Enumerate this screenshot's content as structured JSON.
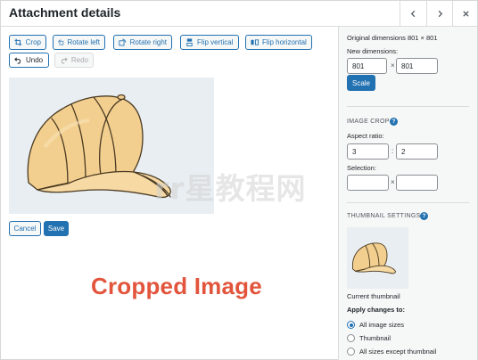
{
  "header": {
    "title": "Attachment details"
  },
  "toolbar": {
    "crop": "Crop",
    "rotate_left": "Rotate left",
    "rotate_right": "Rotate right",
    "flip_vertical": "Flip vertical",
    "flip_horizontal": "Flip horizontal",
    "undo": "Undo",
    "redo": "Redo"
  },
  "editor": {
    "cancel": "Cancel",
    "save": "Save"
  },
  "caption": "Cropped Image",
  "watermark": "rr星教程网",
  "sidebar": {
    "original_dimensions": "Original dimensions 801 × 801",
    "new_dimensions_label": "New dimensions:",
    "width_value": "801",
    "height_value": "801",
    "times": "×",
    "scale_button": "Scale",
    "image_crop_heading": "IMAGE CROP",
    "aspect_ratio_label": "Aspect ratio:",
    "aspect_w": "3",
    "aspect_h": "2",
    "colon": ":",
    "selection_label": "Selection:",
    "selection_w": "",
    "selection_h": "",
    "thumbnail_heading": "THUMBNAIL SETTINGS",
    "current_thumbnail": "Current thumbnail",
    "apply_changes": "Apply changes to:",
    "options": [
      {
        "label": "All image sizes",
        "checked": true
      },
      {
        "label": "Thumbnail",
        "checked": false
      },
      {
        "label": "All sizes except thumbnail",
        "checked": false
      }
    ]
  },
  "colors": {
    "accent": "#2271b1",
    "caption": "#e2553c",
    "cap_fill": "#f3cf8f"
  }
}
